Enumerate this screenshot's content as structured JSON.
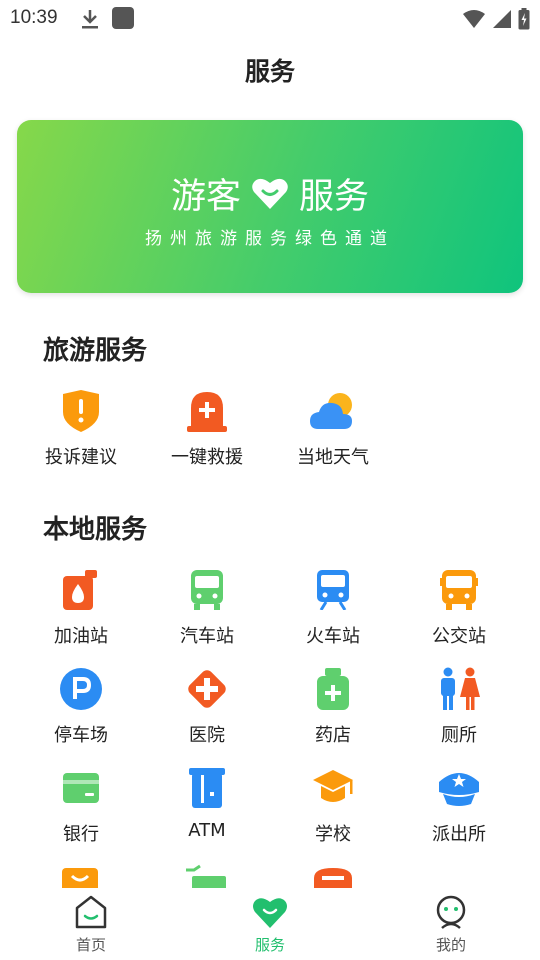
{
  "status_bar": {
    "time": "10:39"
  },
  "header": {
    "title": "服务"
  },
  "banner": {
    "headline_left": "游客",
    "headline_right": "服务",
    "subtitle": "扬州旅游服务绿色通道"
  },
  "sections": {
    "tourism": {
      "title": "旅游服务",
      "items": [
        {
          "label": "投诉建议",
          "icon": "complaint-shield-icon"
        },
        {
          "label": "一键救援",
          "icon": "rescue-siren-icon"
        },
        {
          "label": "当地天气",
          "icon": "weather-cloud-sun-icon"
        }
      ]
    },
    "local": {
      "title": "本地服务",
      "items": [
        {
          "label": "加油站",
          "icon": "gas-station-icon"
        },
        {
          "label": "汽车站",
          "icon": "bus-station-icon"
        },
        {
          "label": "火车站",
          "icon": "train-station-icon"
        },
        {
          "label": "公交站",
          "icon": "bus-stop-icon"
        },
        {
          "label": "停车场",
          "icon": "parking-icon"
        },
        {
          "label": "医院",
          "icon": "hospital-icon"
        },
        {
          "label": "药店",
          "icon": "pharmacy-icon"
        },
        {
          "label": "厕所",
          "icon": "toilet-icon"
        },
        {
          "label": "银行",
          "icon": "bank-card-icon"
        },
        {
          "label": "ATM",
          "icon": "atm-icon"
        },
        {
          "label": "学校",
          "icon": "school-cap-icon"
        },
        {
          "label": "派出所",
          "icon": "police-icon"
        }
      ]
    }
  },
  "tabbar": {
    "items": [
      {
        "label": "首页",
        "icon": "home-icon",
        "active": false
      },
      {
        "label": "服务",
        "icon": "service-heart-icon",
        "active": true
      },
      {
        "label": "我的",
        "icon": "profile-icon",
        "active": false
      }
    ]
  },
  "colors": {
    "accent": "#22bf6e",
    "banner_start": "#86d84a",
    "banner_end": "#0fc47d",
    "orange": "#fb9a0c",
    "red_orange": "#f25a22",
    "green": "#5fcf6e",
    "blue": "#2b8cf3"
  }
}
